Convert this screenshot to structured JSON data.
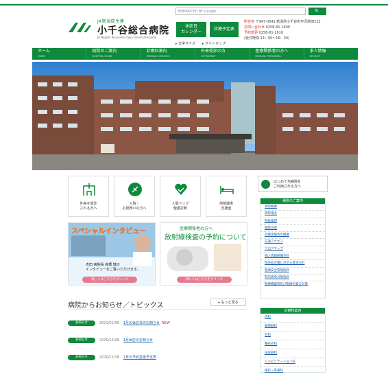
{
  "colors": {
    "brand": "#0f8a3c",
    "alert": "#d0312d",
    "link": "#1a5fa8",
    "pink": "#e7798e"
  },
  "header": {
    "org_small": "JA新潟厚生連",
    "hospital_name": "小千谷総合病院",
    "hospital_en": "JA Niigata Kouseiren Ojiya General Hospital",
    "search_placeholder": "ENHANCED BY Google",
    "search_button": "🔍",
    "holiday_calendar": "休診日\nカレンダー",
    "appointment_change": "診療予定表",
    "contact_address_label": "所在地",
    "contact_address": "〒947-0041 新潟県小千谷市平沢新田111",
    "contact_inquiry_label": "お問い合わせ",
    "contact_inquiry": "0258-81-1600",
    "contact_reserve_label": "予約変更",
    "contact_reserve": "0258-81-1610",
    "contact_hours": "(受付時間 14：00～16：00)",
    "links": [
      "▸ 文字サイズ",
      "▸ サイトマップ"
    ]
  },
  "nav": [
    {
      "label": "ホーム",
      "en": "HOME"
    },
    {
      "label": "病院のご案内",
      "en": "HOSPITAL GUIDE"
    },
    {
      "label": "診療科案内",
      "en": "MEDICAL SERVICES"
    },
    {
      "label": "外来受診の方",
      "en": "OUTPATIENT"
    },
    {
      "label": "医療関係者の方へ",
      "en": "MEDICAL PERSONNEL"
    },
    {
      "label": "求人情報",
      "en": "RECRUIT"
    }
  ],
  "cards": [
    {
      "label": "外来を受診\nされる方へ",
      "icon": "hospital-icon"
    },
    {
      "label": "入院・\nお見舞いの方へ",
      "icon": "flower-icon"
    },
    {
      "label": "人間ドック\n健康診断",
      "icon": "heart-check-icon"
    },
    {
      "label": "地域連携\n支援室",
      "icon": "bed-icon"
    }
  ],
  "banners": {
    "special": {
      "title": "スペシャルインタビュー",
      "caption": "吉田 病院長 高橋 健の\nインタビューをご覧いただけます。",
      "button": "詳しくはこちらをクリック"
    },
    "radiology": {
      "title_small": "医療関係者の方へ",
      "title_big": "放射線検査の予約について",
      "button": "詳しくはこちらをクリック"
    }
  },
  "news": {
    "title": "病院からお知らせ／トピックス",
    "more": "▸ もっと見る",
    "items": [
      {
        "badge": "お知らせ",
        "date": "2021/01/06",
        "title": "1月の休診日のお知らせ",
        "new": "NEW"
      },
      {
        "badge": "お知らせ",
        "date": "2020/12/28",
        "title": "1月休診のお知らせ",
        "new": ""
      },
      {
        "badge": "お知らせ",
        "date": "2020/12/18",
        "title": "1月の予約変更予定表",
        "new": ""
      }
    ]
  },
  "sidebar": {
    "first_visit": "はじめて当病院を\nご利用される方へ",
    "guide_header": "病院のご案内",
    "guide_items": [
      "病院概要",
      "病院理念",
      "院長挨拶",
      "病院沿革",
      "診療実績等の概要",
      "交通アクセス",
      "フロアマップ",
      "個人情報保護方針",
      "院外処方箋に対する基本方針",
      "医療安全管理指針",
      "院内感染対策指針",
      "医療機器等及び医療の安全対策"
    ],
    "dept_header": "診療科案内",
    "dept_items": [
      "内科",
      "循環器科",
      "外科",
      "整形外科",
      "泌尿器科",
      "リハビリテーション科",
      "眼科・耳鼻科"
    ]
  }
}
